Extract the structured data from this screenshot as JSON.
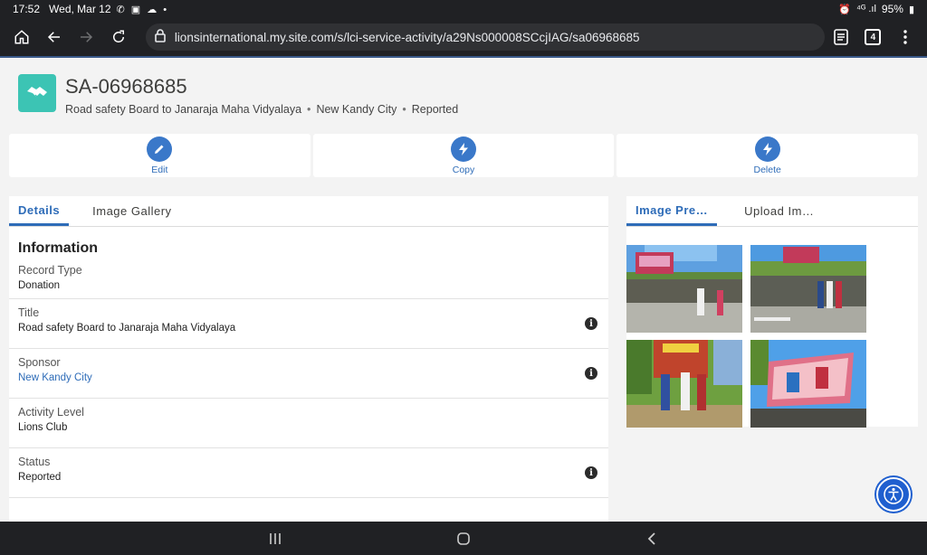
{
  "status_bar": {
    "time": "17:52",
    "date": "Wed, Mar 12",
    "notifications": "✆ ▣ ☁ •",
    "signal": "⁴ᴳ .ıl",
    "battery": "95%"
  },
  "browser": {
    "url": "lionsinternational.my.site.com/s/lci-service-activity/a29Ns000008SCcjIAG/sa06968685",
    "tab_count": "4"
  },
  "record": {
    "title": "SA-06968685",
    "subtitle_parts": [
      "Road safety Board to Janaraja Maha Vidyalaya",
      "New Kandy City",
      "Reported"
    ]
  },
  "actions": [
    {
      "label": "Edit"
    },
    {
      "label": "Copy"
    },
    {
      "label": "Delete"
    }
  ],
  "details": {
    "tabs": [
      "Details",
      "Image Gallery"
    ],
    "section_title": "Information",
    "fields": [
      {
        "label": "Record Type",
        "value": "Donation"
      },
      {
        "label": "Title",
        "value": "Road safety Board to Janaraja Maha Vidyalaya"
      },
      {
        "label": "Sponsor",
        "value": "New Kandy City"
      },
      {
        "label": "Activity Level",
        "value": "Lions Club"
      },
      {
        "label": "Status",
        "value": "Reported"
      }
    ]
  },
  "image_panel": {
    "tabs": [
      "Image Pre…",
      "Upload Im…"
    ],
    "thumbnails": [
      "photo-roadside-board",
      "photo-group-by-wall",
      "photo-group-at-school-gate",
      "photo-safety-board"
    ]
  },
  "colors": {
    "accent": "#2e6cb8",
    "record_icon": "#3cc4b4",
    "action_circle": "#3a78c9"
  }
}
